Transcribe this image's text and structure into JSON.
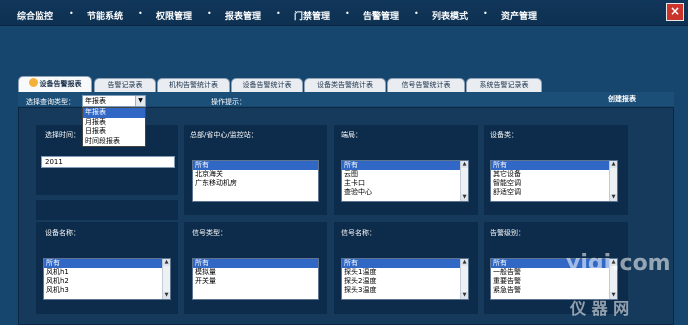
{
  "nav": {
    "items": [
      "综合监控",
      "节能系统",
      "权限管理",
      "报表管理",
      "门禁管理",
      "告警管理",
      "列表模式",
      "资产管理"
    ],
    "close": "×"
  },
  "tabs": [
    "设备告警报表",
    "告警记录表",
    "机构告警统计表",
    "设备告警统计表",
    "设备类告警统计表",
    "信号告警统计表",
    "系统告警记录表"
  ],
  "toolbar": {
    "query_label": "选择查询类型：",
    "query_value": "年报表",
    "options": [
      "年报表",
      "月报表",
      "日报表",
      "时间段报表"
    ],
    "hint_label": "操作提示：",
    "create": "创建报表"
  },
  "filters": {
    "time": {
      "title": "选择时间：",
      "value": "2011"
    },
    "org": {
      "title": "总部/省中心/监控站：",
      "items": [
        "所有",
        "北京海关",
        "广东移动机房"
      ]
    },
    "port": {
      "title": "端局：",
      "items": [
        "所有",
        "云图",
        "主卡口",
        "查验中心"
      ]
    },
    "devtype": {
      "title": "设备类：",
      "items": [
        "所有",
        "其它设备",
        "智能空调",
        "舒适空调"
      ]
    },
    "devname": {
      "title": "设备名称：",
      "items": [
        "所有",
        "风机h1",
        "风机h2",
        "风机h3"
      ]
    },
    "sigtype": {
      "title": "信号类型：",
      "items": [
        "所有",
        "模拟量",
        "开关量"
      ]
    },
    "signame": {
      "title": "信号名称：",
      "items": [
        "所有",
        "探头1温度",
        "探头2温度",
        "探头3温度"
      ]
    },
    "level": {
      "title": "告警级别：",
      "items": [
        "所有",
        "一般告警",
        "重要告警",
        "紧急告警"
      ]
    }
  },
  "watermark": {
    "line1": "yiqi.com",
    "line2": "仪  器  网"
  }
}
